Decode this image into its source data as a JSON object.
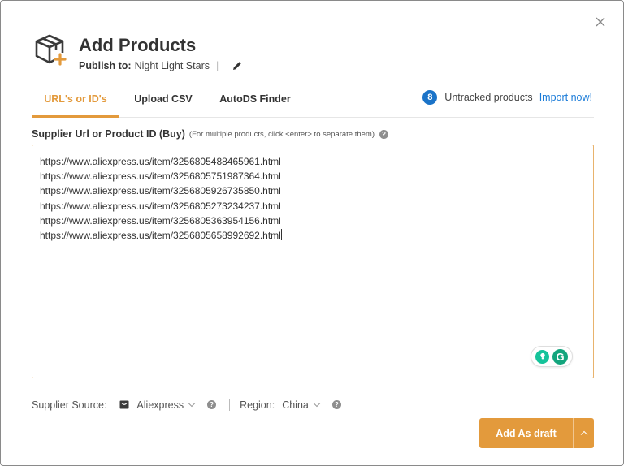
{
  "header": {
    "title": "Add Products",
    "publish_label": "Publish to:",
    "store_name": "Night Light Stars",
    "separator": "|"
  },
  "tabs": [
    {
      "label": "URL's or ID's",
      "active": true
    },
    {
      "label": "Upload CSV",
      "active": false
    },
    {
      "label": "AutoDS Finder",
      "active": false
    }
  ],
  "untracked": {
    "count": "8",
    "text": "Untracked products",
    "link": "Import now!"
  },
  "field": {
    "label": "Supplier Url or Product ID (Buy)",
    "hint": "(For multiple products, click <enter> to separate them)",
    "urls": [
      "https://www.aliexpress.us/item/3256805488465961.html",
      "https://www.aliexpress.us/item/3256805751987364.html",
      "https://www.aliexpress.us/item/3256805926735850.html",
      "https://www.aliexpress.us/item/3256805273234237.html",
      "https://www.aliexpress.us/item/3256805363954156.html",
      "https://www.aliexpress.us/item/3256805658992692.html"
    ]
  },
  "bottom": {
    "supplier_label": "Supplier Source:",
    "supplier_value": "Aliexpress",
    "region_label": "Region:",
    "region_value": "China"
  },
  "actions": {
    "add_label": "Add As draft"
  },
  "colors": {
    "accent": "#e39a3c",
    "link": "#1a7bd8",
    "badge": "#1a73c8",
    "grammarly": "#15c39a"
  },
  "icons": [
    "box-plus-icon",
    "pencil-icon",
    "close-icon",
    "help-icon",
    "store-icon",
    "chevron-down-icon",
    "chevron-up-icon",
    "bulb-icon",
    "grammarly-icon"
  ]
}
